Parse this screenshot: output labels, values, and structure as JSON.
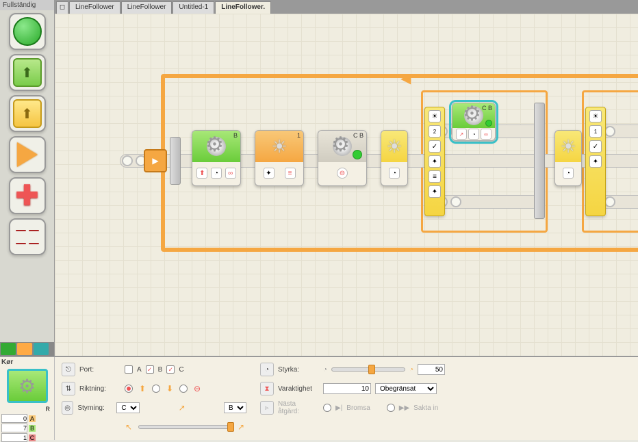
{
  "palette": {
    "title": "Fullständig"
  },
  "tabs": {
    "items": [
      {
        "label": "LineFollower"
      },
      {
        "label": "LineFollower"
      },
      {
        "label": "Untitled-1"
      },
      {
        "label": "LineFollower."
      }
    ],
    "active_index": 3
  },
  "blocks": {
    "b1_port": "B",
    "b2_port": "1",
    "b3_port": "C B",
    "switch1_port": "2",
    "sel_port": "C B",
    "switch2_port": "1"
  },
  "config": {
    "title": "Kør",
    "port": {
      "label": "Port:",
      "A": false,
      "B": true,
      "C": true,
      "a_lbl": "A",
      "b_lbl": "B",
      "c_lbl": "C"
    },
    "direction": {
      "label": "Riktning:"
    },
    "steering": {
      "label": "Styrning:",
      "left": "C",
      "right": "B"
    },
    "power": {
      "label": "Styrka:",
      "value": "50"
    },
    "duration": {
      "label": "Varaktighet",
      "value": "10",
      "mode": "Obegränsat"
    },
    "next": {
      "label": "Nästa åtgärd:",
      "brake": "Bromsa",
      "coast": "Sakta in"
    },
    "port_vals": {
      "a": "0",
      "b": "7",
      "c": "1",
      "r": "R",
      "al": "A",
      "bl": "B",
      "cl": "C"
    }
  }
}
